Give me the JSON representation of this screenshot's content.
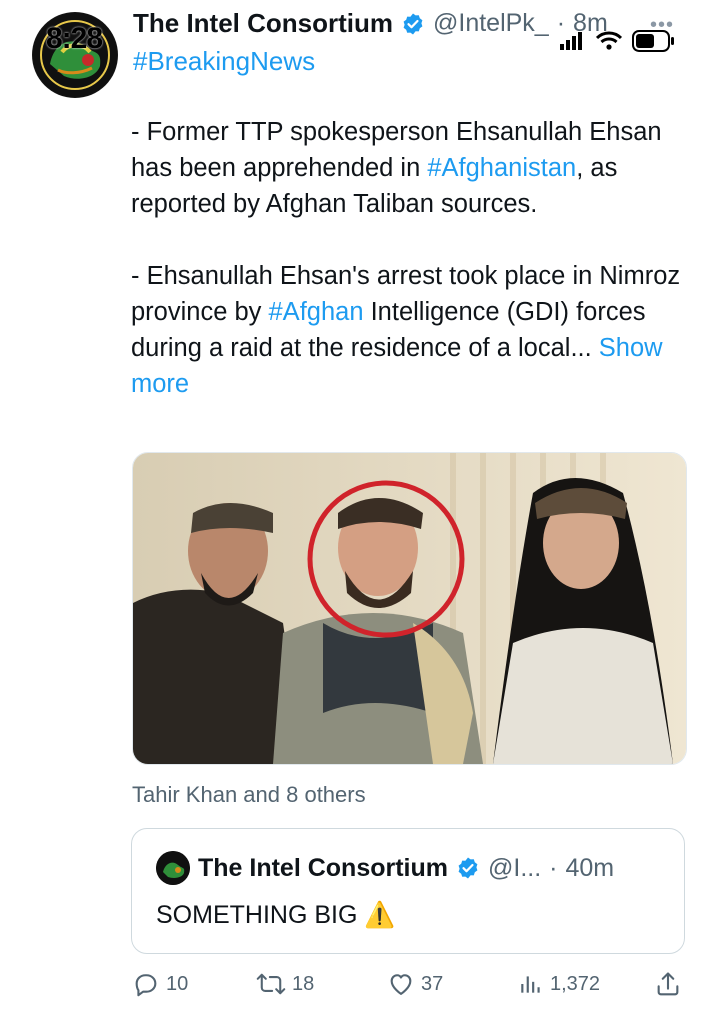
{
  "status_bar": {
    "time": "8:28"
  },
  "tweet": {
    "author_name": "The Intel Consortium",
    "handle": "@IntelPk_",
    "time_ago": "8m",
    "hashtag": "#BreakingNews",
    "para1": {
      "line_a": "- Former TTP spokesperson Ehsanullah Ehsan has been apprehended in ",
      "link": "#Afghanistan",
      "line_b": ", as reported by Afghan Taliban sources."
    },
    "para2": {
      "line_a": "- Ehsanullah Ehsan's arrest took place in Nimroz province by ",
      "link": "#Afghan",
      "line_b": " Intelligence (GDI) forces during a raid at the residence of a local...",
      "show_more": "Show more"
    },
    "tagged": "Tahir Khan and 8 others"
  },
  "quote": {
    "author_name": "The Intel Consortium",
    "handle": "@I...",
    "time_ago": "40m",
    "text": "SOMETHING BIG",
    "emoji": "⚠️"
  },
  "actions": {
    "replies": "10",
    "retweets": "18",
    "likes": "37",
    "views": "1,372"
  },
  "colors": {
    "accent": "#1d9bf0",
    "text": "#0f1419",
    "secondary": "#536471",
    "circle": "#d0232b"
  },
  "icons": [
    "verified-icon",
    "wifi-icon",
    "signal-icon",
    "battery-icon",
    "reply-icon",
    "retweet-icon",
    "like-icon",
    "views-icon",
    "share-icon",
    "more-icon"
  ]
}
